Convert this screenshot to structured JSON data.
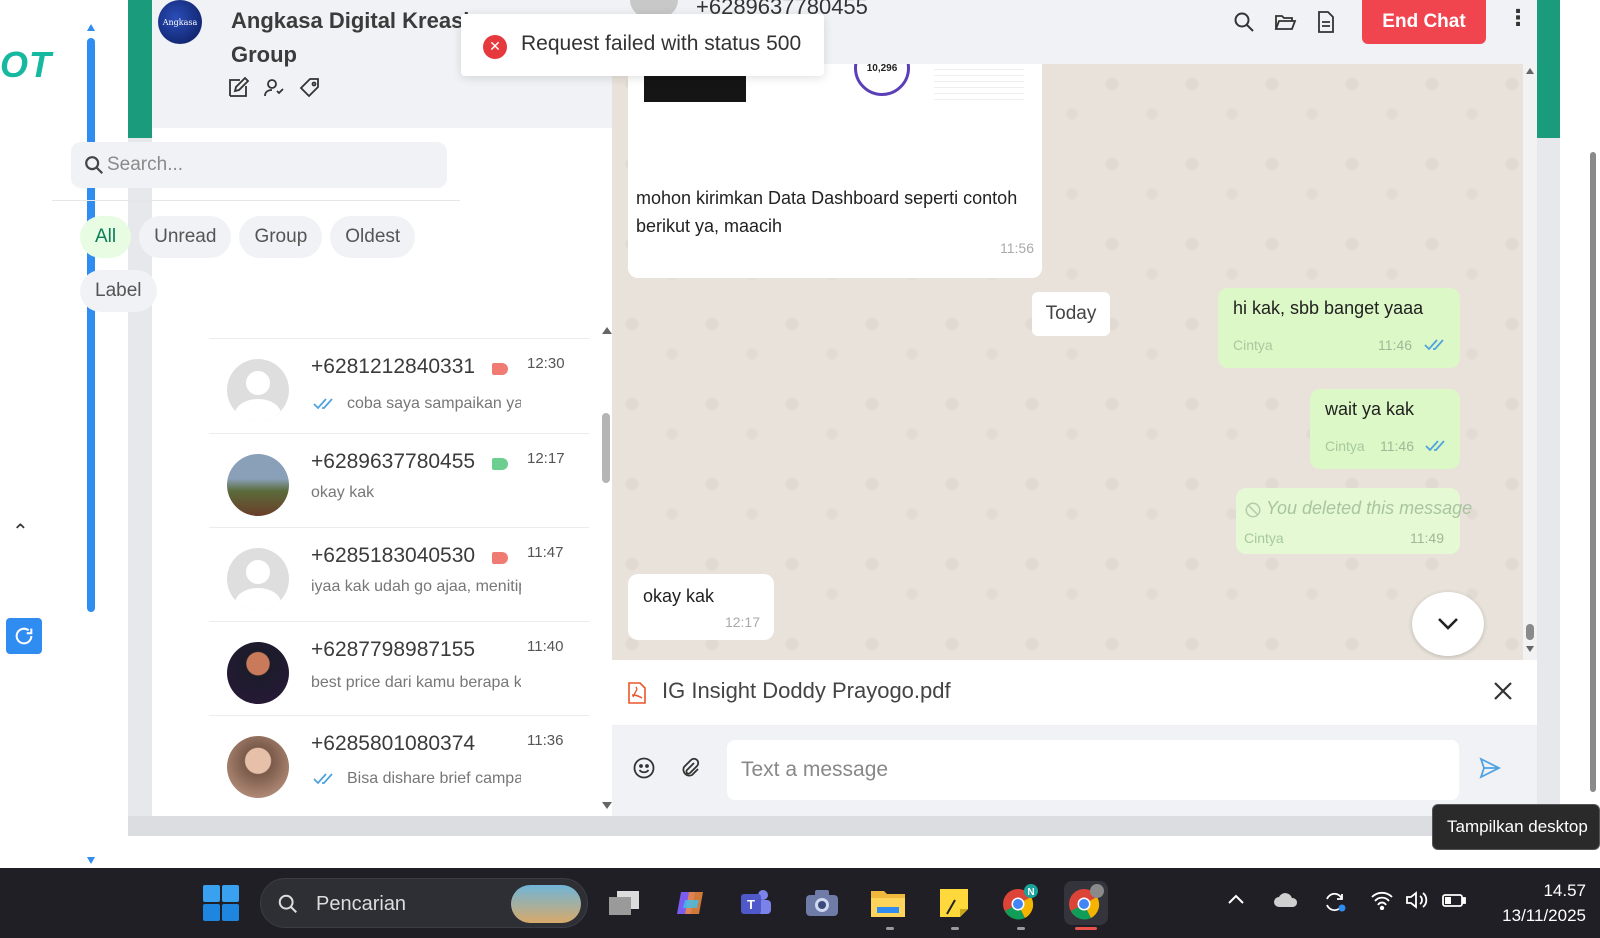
{
  "toast": {
    "message": "Request failed with status 500"
  },
  "sidebar": {
    "group_avatar_text": "Angkasa",
    "group_name": "Angkasa Digital Kreasi Group",
    "search_placeholder": "Search...",
    "filters": [
      {
        "label": "All",
        "active": true
      },
      {
        "label": "Unread",
        "active": false
      },
      {
        "label": "Group",
        "active": false
      },
      {
        "label": "Oldest",
        "active": false
      },
      {
        "label": "Label",
        "active": false
      }
    ],
    "chats": [
      {
        "phone": "+6281212840331",
        "time": "12:30",
        "preview": "coba saya sampaikan ya",
        "double_tick": true,
        "tag_color": "#f07b72",
        "avatar": "default"
      },
      {
        "phone": "+6289637780455",
        "time": "12:17",
        "preview": "okay kak",
        "double_tick": false,
        "tag_color": "#6dcf8f",
        "avatar": "photo-outdoor"
      },
      {
        "phone": "+6285183040530",
        "time": "11:47",
        "preview": "iyaa kak udah go ajaa, menitip",
        "double_tick": false,
        "tag_color": "#f07b72",
        "avatar": "default"
      },
      {
        "phone": "+6287798987155",
        "time": "11:40",
        "preview": "best price dari kamu berapa ka",
        "double_tick": false,
        "tag_color": "",
        "avatar": "photo-dark"
      },
      {
        "phone": "+6285801080374",
        "time": "11:36",
        "preview": "Bisa dishare brief campaign",
        "double_tick": true,
        "tag_color": "",
        "avatar": "photo-woman"
      }
    ]
  },
  "chat": {
    "contact_phone": "+6289637780455",
    "end_chat_label": "End Chat",
    "image_message": {
      "thumb_number": "10,296",
      "text": "mohon kirimkan Data Dashboard seperti contoh berikut ya, maacih",
      "time": "11:56"
    },
    "date_separator": "Today",
    "outgoing": [
      {
        "text": "hi kak, sbb banget yaaa",
        "sender": "Cintya",
        "time": "11:46",
        "deleted": false
      },
      {
        "text": "wait ya kak",
        "sender": "Cintya",
        "time": "11:46",
        "deleted": false
      },
      {
        "text": "You deleted this message",
        "sender": "Cintya",
        "time": "11:49",
        "deleted": true
      }
    ],
    "incoming_last": {
      "text": "okay kak",
      "time": "12:17"
    },
    "attachment": {
      "filename": "IG Insight Doddy Prayogo.pdf"
    },
    "composer_placeholder": "Text a message"
  },
  "tooltip": {
    "text": "Tampilkan desktop"
  },
  "taskbar": {
    "search_label": "Pencarian",
    "time": "14.57",
    "date": "13/11/2025",
    "chrome_profile_badge": "N"
  },
  "colors": {
    "accent_green": "#1a9b7c",
    "end_chat_red": "#f0444f",
    "outgoing_bubble": "#dcf8c6",
    "error_red": "#e5393d",
    "tick_blue": "#4fa3e0"
  }
}
